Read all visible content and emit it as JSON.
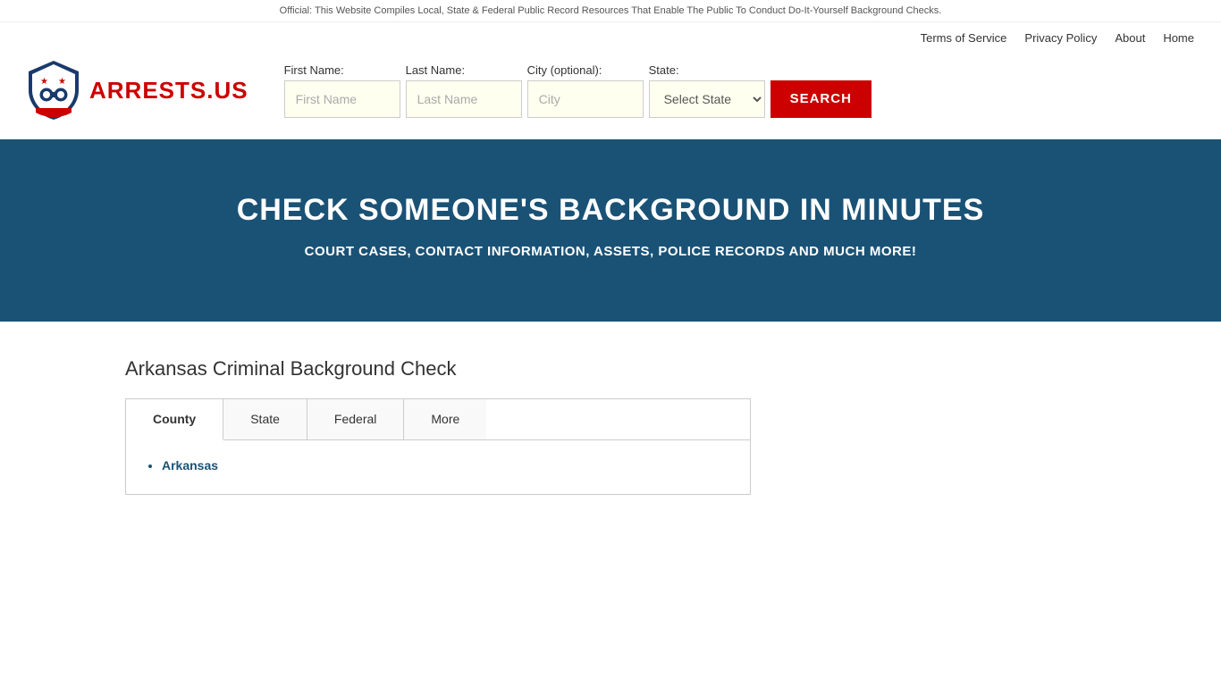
{
  "topbar": {
    "text": "Official: This Website Compiles Local, State & Federal Public Record Resources That Enable The Public To Conduct Do-It-Yourself Background Checks."
  },
  "nav": {
    "links": [
      {
        "label": "Terms of Service",
        "href": "#"
      },
      {
        "label": "Privacy Policy",
        "href": "#"
      },
      {
        "label": "About",
        "href": "#"
      },
      {
        "label": "Home",
        "href": "#"
      }
    ]
  },
  "logo": {
    "text_part1": "ARRESTS",
    "text_part2": ".US"
  },
  "search": {
    "firstname_label": "First Name:",
    "firstname_placeholder": "First Name",
    "lastname_label": "Last Name:",
    "lastname_placeholder": "Last Name",
    "city_label": "City (optional):",
    "city_placeholder": "City",
    "state_label": "State:",
    "state_placeholder": "Select State",
    "button_label": "SEARCH"
  },
  "hero": {
    "heading": "CHECK SOMEONE'S BACKGROUND IN MINUTES",
    "subheading": "COURT CASES, CONTACT INFORMATION, ASSETS, POLICE RECORDS AND MUCH MORE!"
  },
  "section": {
    "title": "Arkansas Criminal Background Check"
  },
  "tabs": [
    {
      "label": "County",
      "active": true
    },
    {
      "label": "State",
      "active": false
    },
    {
      "label": "Federal",
      "active": false
    },
    {
      "label": "More",
      "active": false
    }
  ],
  "tab_county_items": [
    "Arkansas"
  ]
}
